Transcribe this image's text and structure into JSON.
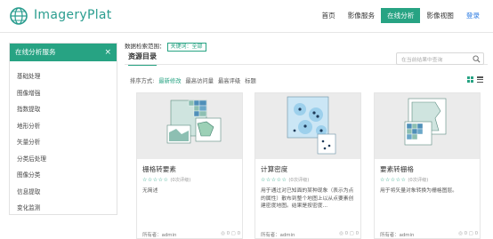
{
  "brand": {
    "name": "ImageryPlat"
  },
  "nav": {
    "items": [
      {
        "label": "首页"
      },
      {
        "label": "影像服务"
      },
      {
        "label": "在线分析"
      },
      {
        "label": "影像视图"
      },
      {
        "label": "登录"
      }
    ],
    "active": "在线分析"
  },
  "sidebar": {
    "title": "在线分析服务",
    "close": "×",
    "items": [
      {
        "label": "基础处理"
      },
      {
        "label": "图像增强"
      },
      {
        "label": "指数提取"
      },
      {
        "label": "地形分析"
      },
      {
        "label": "矢量分析"
      },
      {
        "label": "分类后处理"
      },
      {
        "label": "图像分类"
      },
      {
        "label": "信息提取"
      },
      {
        "label": "变化监测"
      }
    ]
  },
  "main": {
    "range_label": "数据检索范围：",
    "range_tag": "关键词：全部",
    "tab": "资源目录",
    "search_placeholder": "在当前结果中查询",
    "sort_label": "排序方式:",
    "sort_options": [
      {
        "label": "最新修改"
      },
      {
        "label": "最高访问量"
      },
      {
        "label": "最高评级"
      },
      {
        "label": "标题"
      }
    ],
    "accent": "#27a383"
  },
  "cards": [
    {
      "title": "栅格转要素",
      "stars": "☆☆☆☆☆",
      "rating": "(0次评级)",
      "desc": "无简述",
      "owner": "所有者：admin",
      "stats": "◎ 0 ▢ 0"
    },
    {
      "title": "计算密度",
      "stars": "☆☆☆☆☆",
      "rating": "(0次评级)",
      "desc": "用于通过对已知面的某种现象（表示为点的属性）散布到整个地图上以从点要素创建密度地图。结果是按密度...",
      "owner": "所有者：admin",
      "stats": "◎ 0 ▢ 0"
    },
    {
      "title": "要素转栅格",
      "stars": "☆☆☆☆☆",
      "rating": "(0次评级)",
      "desc": "用于将矢量对象转换为栅格图层。",
      "owner": "所有者：admin",
      "stats": "◎ 0 ▢ 0"
    }
  ]
}
